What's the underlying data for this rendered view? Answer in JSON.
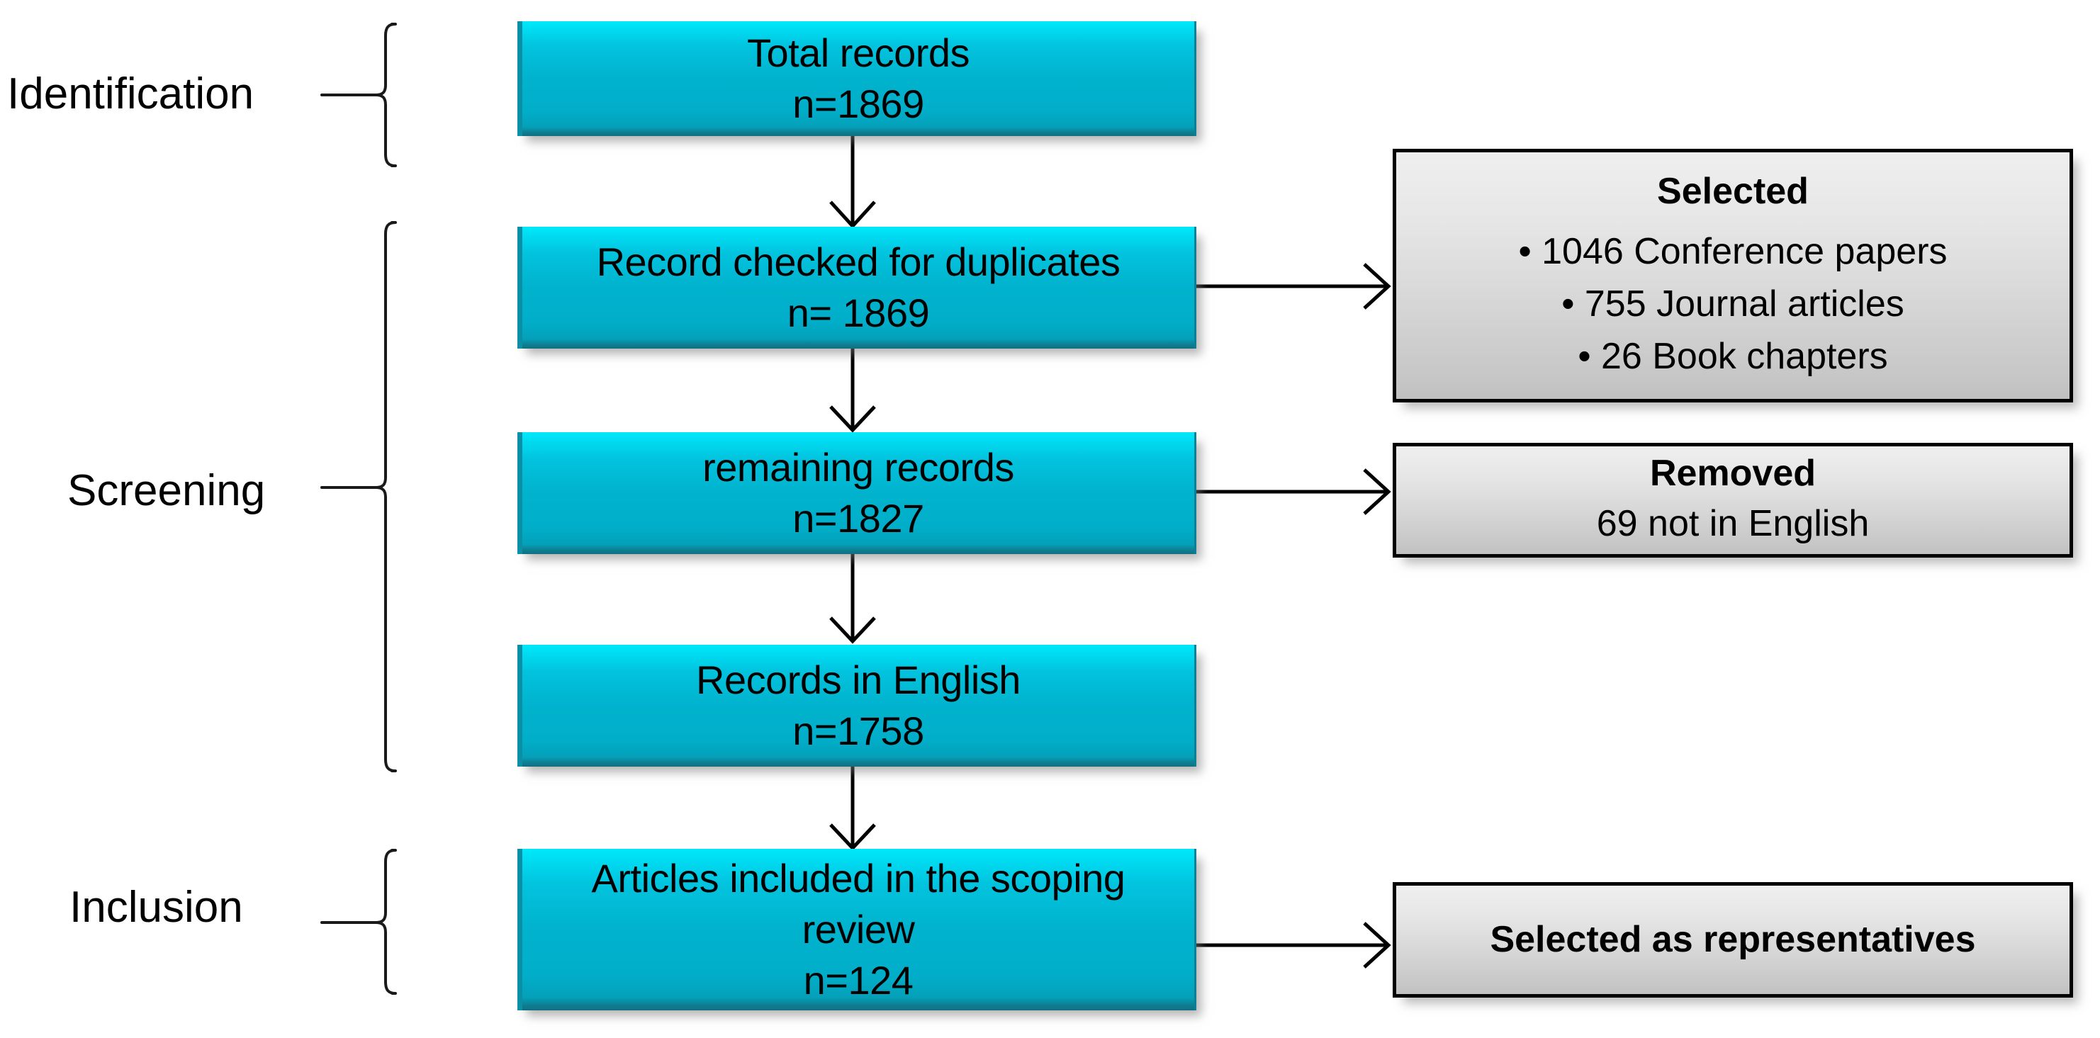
{
  "title": "PRISMA scoping review flow diagram",
  "colors": {
    "box_fill_top": "#00e9fb",
    "box_fill_bottom": "#10707f",
    "grey_fill_top": "#efefef",
    "grey_fill_bottom": "#c0c0c0",
    "line": "#000000",
    "text": "#000000"
  },
  "stages": [
    {
      "id": "identification",
      "label": "Identification"
    },
    {
      "id": "screening",
      "label": "Screening"
    },
    {
      "id": "inclusion",
      "label": "Inclusion"
    }
  ],
  "flow_boxes": [
    {
      "id": "total-records",
      "lines": [
        "Total  records",
        "n=1869"
      ]
    },
    {
      "id": "records-checked-duplicates",
      "lines": [
        "Record checked for duplicates",
        "n= 1869"
      ]
    },
    {
      "id": "remaining-records",
      "lines": [
        "remaining records",
        "n=1827"
      ]
    },
    {
      "id": "records-in-english",
      "lines": [
        "Records in English",
        "n=1758"
      ]
    },
    {
      "id": "articles-included",
      "lines": [
        "Articles included in the scoping review",
        "n=124"
      ]
    }
  ],
  "side_boxes": [
    {
      "id": "selected",
      "title": "Selected",
      "items": [
        "• 1046 Conference papers",
        "•  755 Journal articles",
        "• 26 Book chapters"
      ]
    },
    {
      "id": "removed",
      "title": "Removed",
      "items": [
        "69 not in English"
      ]
    },
    {
      "id": "selected-as-representatives",
      "title": "Selected as representatives",
      "items": []
    }
  ],
  "chart_data": {
    "type": "diagram",
    "title": "PRISMA scoping review flow diagram",
    "stages": [
      "Identification",
      "Screening",
      "Inclusion"
    ],
    "nodes": [
      {
        "id": "total-records",
        "stage": "Identification",
        "label": "Total  records",
        "n": 1869
      },
      {
        "id": "records-checked-duplicates",
        "stage": "Screening",
        "label": "Record checked for duplicates",
        "n": 1869
      },
      {
        "id": "remaining-records",
        "stage": "Screening",
        "label": "remaining records",
        "n": 1827
      },
      {
        "id": "records-in-english",
        "stage": "Screening",
        "label": "Records in English",
        "n": 1758
      },
      {
        "id": "articles-included",
        "stage": "Inclusion",
        "label": "Articles included in the scoping review",
        "n": 124
      }
    ],
    "side_nodes": [
      {
        "id": "selected",
        "label": "Selected",
        "breakdown": [
          {
            "count": 1046,
            "type": "Conference papers"
          },
          {
            "count": 755,
            "type": "Journal articles"
          },
          {
            "count": 26,
            "type": "Book chapters"
          }
        ]
      },
      {
        "id": "removed",
        "label": "Removed",
        "breakdown": [
          {
            "count": 69,
            "type": "not in English"
          }
        ]
      },
      {
        "id": "selected-as-representatives",
        "label": "Selected as representatives",
        "breakdown": []
      }
    ],
    "edges": [
      {
        "from": "total-records",
        "to": "records-checked-duplicates",
        "direction": "down"
      },
      {
        "from": "records-checked-duplicates",
        "to": "selected",
        "direction": "right"
      },
      {
        "from": "records-checked-duplicates",
        "to": "remaining-records",
        "direction": "down"
      },
      {
        "from": "remaining-records",
        "to": "removed",
        "direction": "right"
      },
      {
        "from": "remaining-records",
        "to": "records-in-english",
        "direction": "down"
      },
      {
        "from": "records-in-english",
        "to": "articles-included",
        "direction": "down"
      },
      {
        "from": "articles-included",
        "to": "selected-as-representatives",
        "direction": "right"
      }
    ]
  }
}
